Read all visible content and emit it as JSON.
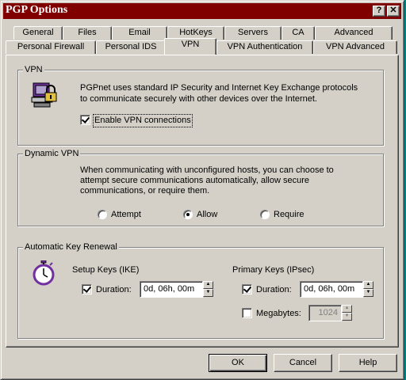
{
  "window": {
    "title": "PGP Options"
  },
  "title_buttons": {
    "help": "?",
    "close": "✕"
  },
  "tabs_row1": [
    "General",
    "Files",
    "Email",
    "HotKeys",
    "Servers",
    "CA",
    "Advanced"
  ],
  "tabs_row2": [
    "Personal Firewall",
    "Personal IDS",
    "VPN",
    "VPN Authentication",
    "VPN Advanced"
  ],
  "active_tab": "VPN",
  "vpn_group": {
    "label": "VPN",
    "icon": "vpn-computer-lock-icon",
    "description_line1": "PGPnet uses standard IP Security and Internet Key Exchange protocols",
    "description_line2": "to communicate securely with other devices over the Internet.",
    "enable_label": "Enable VPN connections",
    "enable_checked": true
  },
  "dynamic_group": {
    "label": "Dynamic VPN",
    "description_line1": "When communicating with unconfigured hosts, you can choose to",
    "description_line2": "attempt secure communications automatically, allow secure",
    "description_line3": "communications, or require them.",
    "options": [
      "Attempt",
      "Allow",
      "Require"
    ],
    "selected": "Allow"
  },
  "renewal_group": {
    "label": "Automatic Key Renewal",
    "icon": "stopwatch-icon",
    "setup_keys": {
      "heading": "Setup Keys (IKE)",
      "duration_label": "Duration:",
      "duration_checked": true,
      "duration_value": "0d, 06h, 00m"
    },
    "primary_keys": {
      "heading": "Primary Keys (IPsec)",
      "duration_label": "Duration:",
      "duration_checked": true,
      "duration_value": "0d, 06h, 00m",
      "megabytes_label": "Megabytes:",
      "megabytes_checked": false,
      "megabytes_value": "1024"
    }
  },
  "buttons": {
    "ok": "OK",
    "cancel": "Cancel",
    "help": "Help"
  },
  "colors": {
    "title_bar": "#800000",
    "face": "#d4d0c8",
    "icon_purple": "#7030a0"
  }
}
